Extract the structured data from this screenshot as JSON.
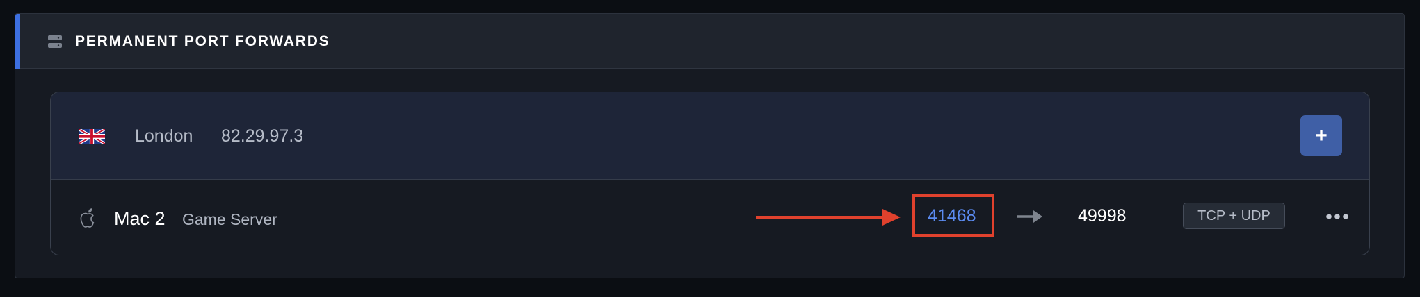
{
  "panel": {
    "title": "PERMANENT PORT FORWARDS",
    "icon": "server-icon",
    "accent_color": "#3d6fe0"
  },
  "location": {
    "flag": "uk-flag-icon",
    "name": "London",
    "ip": "82.29.97.3",
    "add_label": "+",
    "add_button_color": "#3f5fa6"
  },
  "forwards": [
    {
      "device_icon": "apple-icon",
      "device_name": "Mac 2",
      "label": "Game Server",
      "external_port": "41468",
      "internal_port": "49998",
      "protocol": "TCP + UDP",
      "more_icon": "ellipsis-icon"
    }
  ],
  "annotation": {
    "color": "#e0412d",
    "arrow_icon": "red-arrow-icon"
  }
}
